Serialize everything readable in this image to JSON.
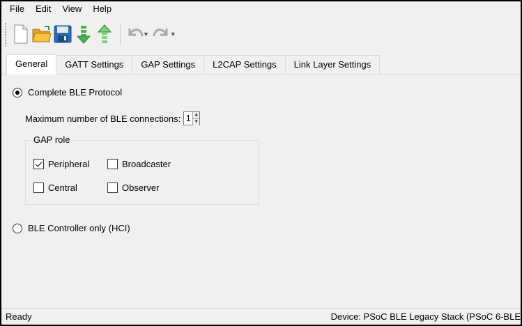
{
  "menu": {
    "items": [
      "File",
      "Edit",
      "View",
      "Help"
    ]
  },
  "toolbar": {
    "icons": [
      "new-file-icon",
      "open-folder-icon",
      "save-icon",
      "import-icon",
      "export-icon",
      "undo-icon",
      "redo-icon"
    ]
  },
  "tabs": [
    "General",
    "GATT Settings",
    "GAP Settings",
    "L2CAP Settings",
    "Link Layer Settings"
  ],
  "active_tab": "General",
  "general": {
    "complete_ble_label": "Complete BLE Protocol",
    "complete_ble_selected": true,
    "max_connections_label": "Maximum number of BLE connections:",
    "max_connections_value": "1",
    "gap_role_title": "GAP role",
    "roles": {
      "peripheral": {
        "label": "Peripheral",
        "checked": true
      },
      "broadcaster": {
        "label": "Broadcaster",
        "checked": false
      },
      "central": {
        "label": "Central",
        "checked": false
      },
      "observer": {
        "label": "Observer",
        "checked": false
      }
    },
    "controller_only_label": "BLE Controller only (HCI)",
    "controller_only_selected": false
  },
  "status": {
    "left": "Ready",
    "right": "Device: PSoC BLE Legacy Stack (PSoC 6-BLE"
  },
  "colors": {
    "window_bg": "#f0f0f0",
    "folder_yellow": "#f5b82e",
    "save_blue": "#2b6cb3",
    "arrow_green": "#4caf50",
    "disabled_gray": "#a9a9a9"
  }
}
